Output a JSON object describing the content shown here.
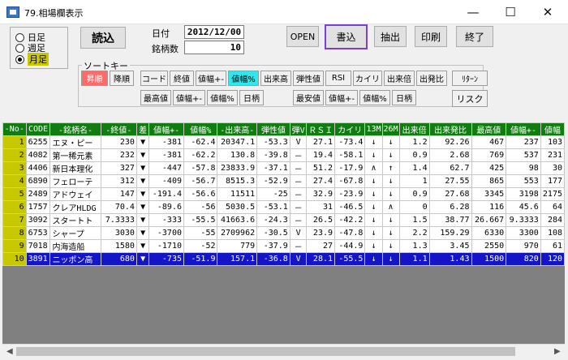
{
  "window": {
    "title": "79.相場欄表示"
  },
  "period": {
    "options": [
      "日足",
      "週足",
      "月足"
    ],
    "selected": 2
  },
  "buttons": {
    "read": "読込",
    "open": "OPEN",
    "write": "書込",
    "extract": "抽出",
    "print": "印刷",
    "exit": "終了"
  },
  "info": {
    "date_label": "日付",
    "date_value": "2012/12/00",
    "count_label": "銘柄数",
    "count_value": "10"
  },
  "sort": {
    "legend": "ソートキー",
    "asc": "昇順",
    "desc": "降順",
    "row1": [
      "コード",
      "終値",
      "値幅+-",
      "値幅%",
      "出来高",
      "弾性値",
      "RSI",
      "カイリ",
      "出来倍",
      "出発比",
      "ﾘﾀｰﾝ"
    ],
    "row2": [
      "最高値",
      "値幅+-",
      "値幅%",
      "日柄"
    ],
    "row3": [
      "最安値",
      "値幅+-",
      "値幅%",
      "日柄"
    ],
    "risk": "リスク"
  },
  "table": {
    "headers": [
      "-No-",
      "CODE",
      "-銘柄名-",
      "-終値-",
      "差",
      "値幅+-",
      "値幅%",
      "-出来高-",
      "弾性値",
      "弾V",
      "ＲＳＩ",
      "カイリ",
      "13M",
      "26M",
      "出来倍",
      "出来発比",
      "最高値",
      "値幅+-",
      "値幅"
    ],
    "selected_row": 9,
    "rows": [
      [
        "1",
        "6255",
        "エヌ・ピー",
        "230",
        "▼",
        "-381",
        "-62.4",
        "20347.1",
        "-53.3",
        "V",
        "27.1",
        "-73.4",
        "↓",
        "↓",
        "1.2",
        "92.26",
        "467",
        "237",
        "103"
      ],
      [
        "2",
        "4082",
        "第一稀元素",
        "232",
        "▼",
        "-381",
        "-62.2",
        "130.8",
        "-39.8",
        "－",
        "19.4",
        "-58.1",
        "↓",
        "↓",
        "0.9",
        "2.68",
        "769",
        "537",
        "231"
      ],
      [
        "3",
        "4406",
        "新日本理化",
        "327",
        "▼",
        "-447",
        "-57.8",
        "23833.9",
        "-37.1",
        "－",
        "51.2",
        "-17.9",
        "∧",
        "↑",
        "1.4",
        "62.7",
        "425",
        "98",
        "30"
      ],
      [
        "4",
        "6890",
        "フェローテ",
        "312",
        "▼",
        "-409",
        "-56.7",
        "8515.3",
        "-52.9",
        "－",
        "27.4",
        "-67.8",
        "↓",
        "↓",
        "1",
        "27.55",
        "865",
        "553",
        "177"
      ],
      [
        "5",
        "2489",
        "アドウェイ",
        "147",
        "▼",
        "-191.4",
        "-56.6",
        "11511",
        "-25",
        "－",
        "32.9",
        "-23.9",
        "↓",
        "↓",
        "0.9",
        "27.68",
        "3345",
        "3198",
        "2175"
      ],
      [
        "6",
        "1757",
        "クレアHLDG",
        "70.4",
        "▼",
        "-89.6",
        "-56",
        "5030.5",
        "-53.1",
        "－",
        "31",
        "-46.5",
        "↓",
        "∧",
        "0",
        "6.28",
        "116",
        "45.6",
        "64"
      ],
      [
        "7",
        "3092",
        "スタートト",
        "7.3333",
        "▼",
        "-333",
        "-55.5",
        "41663.6",
        "-24.3",
        "－",
        "26.5",
        "-42.2",
        "↓",
        "↓",
        "1.5",
        "38.77",
        "26.667",
        "9.3333",
        "284"
      ],
      [
        "8",
        "6753",
        "シャープ",
        "3030",
        "▼",
        "-3700",
        "-55",
        "2709962",
        "-30.5",
        "V",
        "23.9",
        "-47.8",
        "↓",
        "↓",
        "2.2",
        "159.29",
        "6330",
        "3300",
        "108"
      ],
      [
        "9",
        "7018",
        "内海造船",
        "1580",
        "▼",
        "-1710",
        "-52",
        "779",
        "-37.9",
        "－",
        "27",
        "-44.9",
        "↓",
        "↓",
        "1.3",
        "3.45",
        "2550",
        "970",
        "61"
      ],
      [
        "10",
        "3891",
        "ニッポン高",
        "680",
        "▼",
        "-735",
        "-51.9",
        "157.1",
        "-36.8",
        "V",
        "28.1",
        "-55.5",
        "↓",
        "↓",
        "1.1",
        "1.43",
        "1500",
        "820",
        "120"
      ]
    ]
  }
}
